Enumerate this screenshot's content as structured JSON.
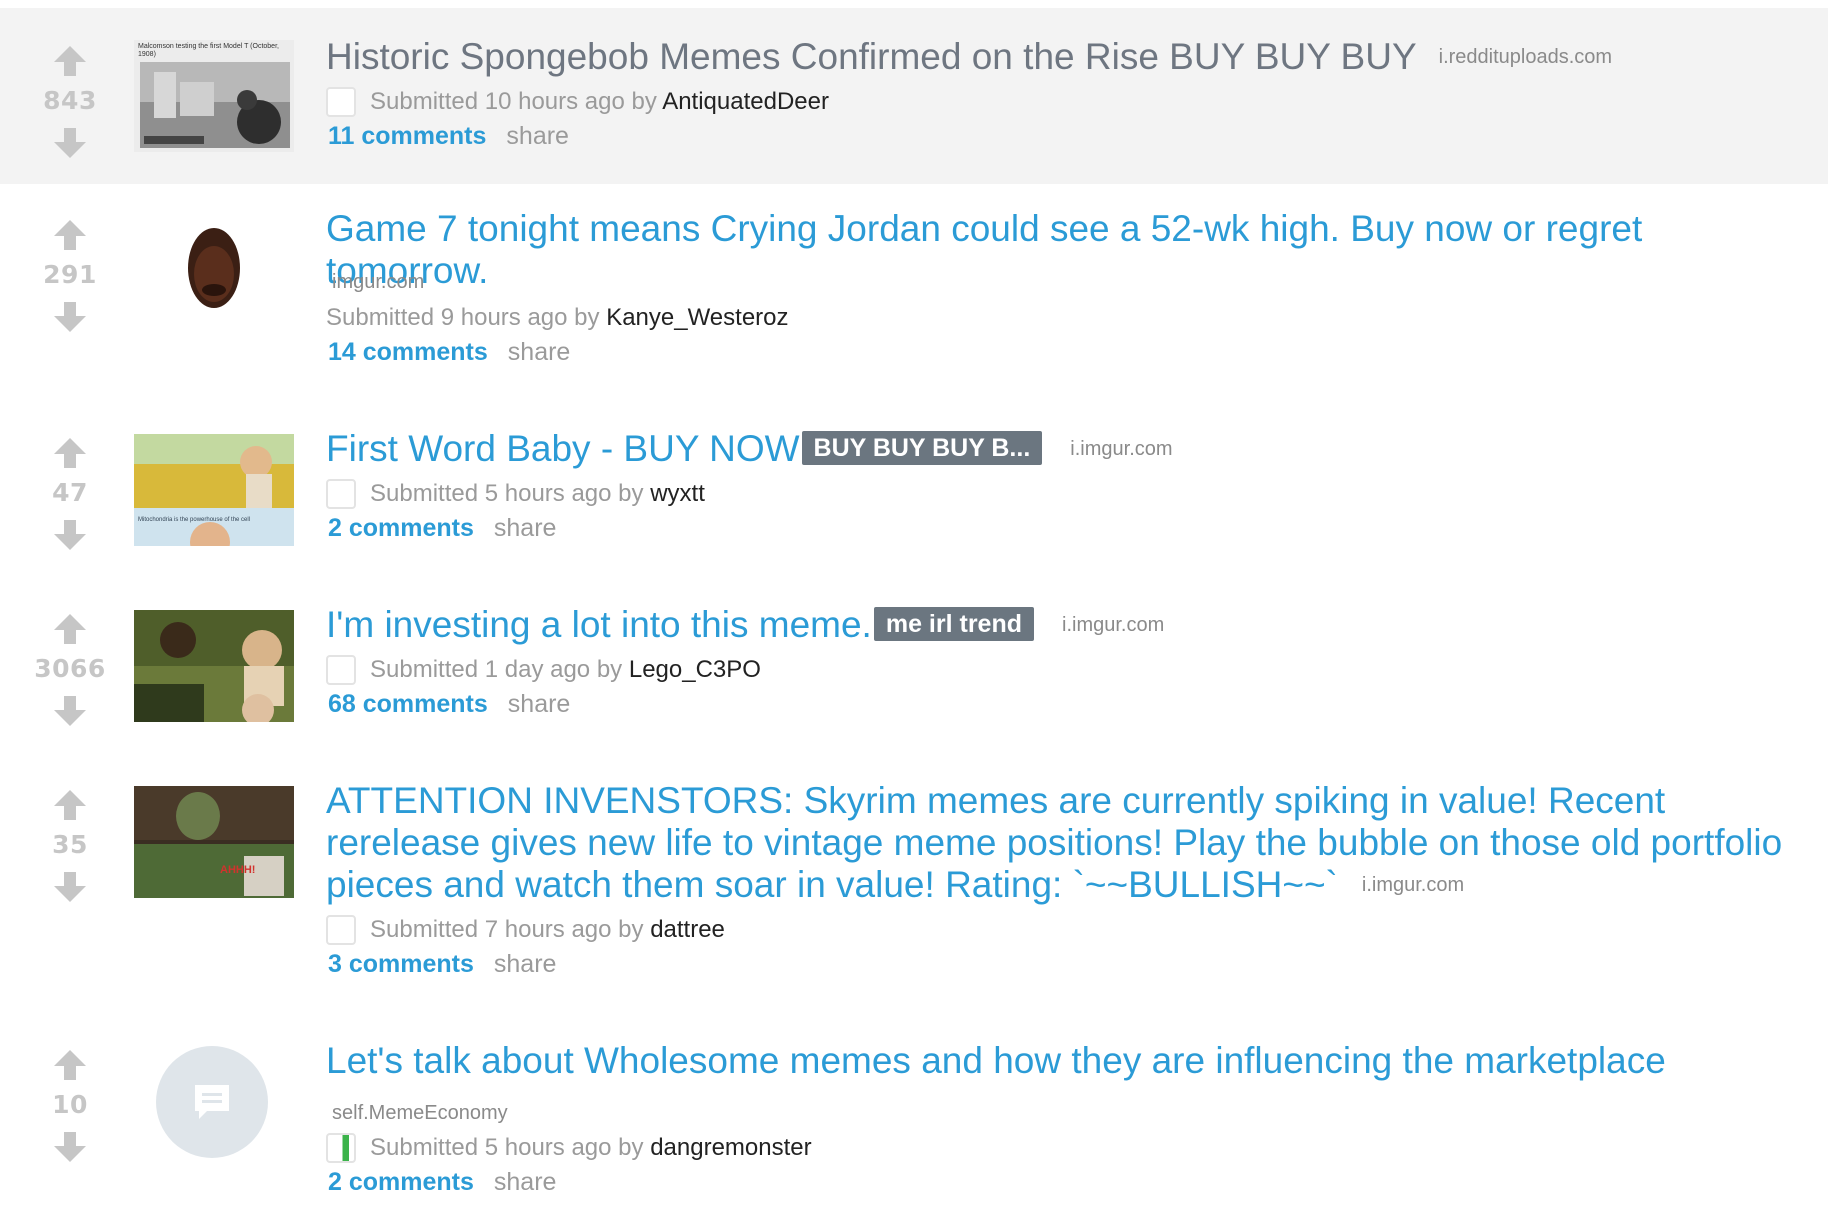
{
  "posts": [
    {
      "score": "843",
      "title": "Historic Spongebob Memes Confirmed on the Rise BUY BUY BUY",
      "flair": "",
      "domain": "i.reddituploads.com",
      "submitted": "Submitted 10 hours ago by",
      "author": "AntiquatedDeer",
      "comments": "11 comments",
      "share": "share",
      "thumb_caption": "Malcomson testing the first Model T (October, 1908)"
    },
    {
      "score": "291",
      "title": "Game 7 tonight means Crying Jordan could see a 52-wk high. Buy now or regret tomorrow.",
      "flair": "",
      "domain": "imgur.com",
      "submitted": "Submitted 9 hours ago by",
      "author": "Kanye_Westeroz",
      "comments": "14 comments",
      "share": "share"
    },
    {
      "score": "47",
      "title": "First Word Baby - BUY NOW",
      "flair": "BUY BUY BUY B...",
      "domain": "i.imgur.com",
      "submitted": "Submitted 5 hours ago by",
      "author": "wyxtt",
      "comments": "2 comments",
      "share": "share",
      "thumb_caption": "Mitochondria is the powerhouse of the cell"
    },
    {
      "score": "3066",
      "title": "I'm investing a lot into this meme.",
      "flair": "me irl trend",
      "domain": "i.imgur.com",
      "submitted": "Submitted 1 day ago by",
      "author": "Lego_C3PO",
      "comments": "68 comments",
      "share": "share"
    },
    {
      "score": "35",
      "title": "ATTENTION INVENSTORS: Skyrim memes are currently spiking in value! Recent rerelease gives new life to vintage meme positions! Play the bubble on those old portfolio pieces and watch them soar in value! Rating: `~~BULLISH~~`",
      "flair": "",
      "domain": "i.imgur.com",
      "submitted": "Submitted 7 hours ago by",
      "author": "dattree",
      "comments": "3 comments",
      "share": "share",
      "thumb_caption": "AHHH!"
    },
    {
      "score": "10",
      "title": "Let's talk about Wholesome memes and how they are influencing the marketplace",
      "flair": "",
      "domain": "self.MemeEconomy",
      "submitted": "Submitted 5 hours ago by",
      "author": "dangremonster",
      "comments": "2 comments",
      "share": "share"
    }
  ],
  "icons": {
    "upvote": "upvote-arrow-icon",
    "downvote": "downvote-arrow-icon",
    "self_post": "chat-bubble-icon"
  },
  "colors": {
    "link": "#2b9bd6",
    "visited": "#6e7681",
    "score": "#c6c6c6",
    "flair_bg": "#6b7680"
  }
}
